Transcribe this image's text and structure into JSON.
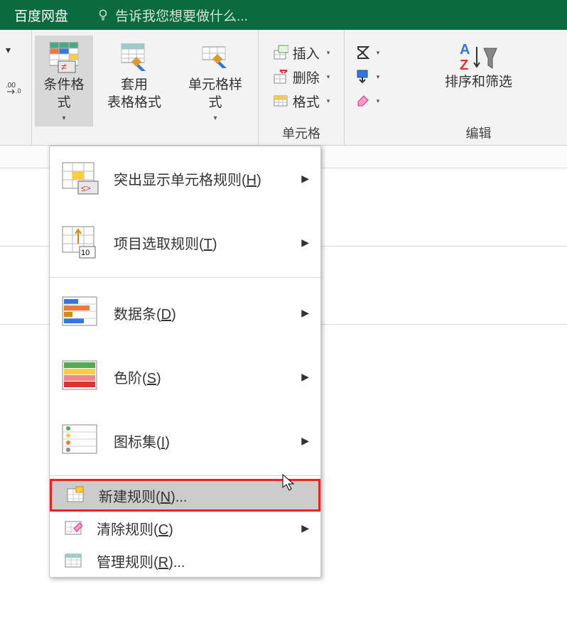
{
  "titlebar": {
    "tab": "百度网盘",
    "tell_me": "告诉我您想要做什么..."
  },
  "ribbon": {
    "cond_format": "条件格式",
    "table_style": "套用\n表格格式",
    "cell_style": "单元格样式",
    "insert": "插入",
    "delete": "删除",
    "format": "格式",
    "cells_label": "单元格",
    "sort_filter": "排序和筛选",
    "edit_label": "编辑"
  },
  "menu": {
    "highlight": "突出显示单元格规则(",
    "highlight_key": "H",
    "top_bottom": "项目选取规则(",
    "top_bottom_key": "T",
    "databars": "数据条(",
    "databars_key": "D",
    "colorscales": "色阶(",
    "colorscales_key": "S",
    "iconsets": "图标集(",
    "iconsets_key": "I",
    "newrule": "新建规则(",
    "newrule_key": "N",
    "newrule_tail": ")...",
    "clear": "清除规则(",
    "clear_key": "C",
    "manage": "管理规则(",
    "manage_key": "R",
    "manage_tail": ")...",
    "close_paren": ")"
  }
}
